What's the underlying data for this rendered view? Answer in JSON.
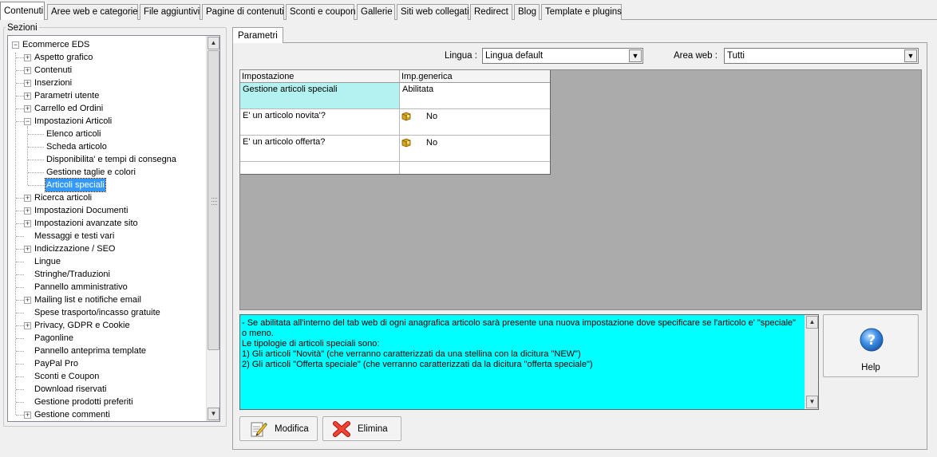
{
  "top_tabs": [
    "Contenuti",
    "Aree web e categorie",
    "File aggiuntivi",
    "Pagine di contenuti",
    "Sconti e coupon",
    "Gallerie",
    "Siti web collegati",
    "Redirect",
    "Blog",
    "Template e plugins"
  ],
  "sections": {
    "legend": "Sezioni",
    "tree": {
      "root": "Ecommerce EDS",
      "items": [
        {
          "label": "Aspetto grafico",
          "expandable": true
        },
        {
          "label": "Contenuti",
          "expandable": true
        },
        {
          "label": "Inserzioni",
          "expandable": true
        },
        {
          "label": "Parametri utente",
          "expandable": true
        },
        {
          "label": "Carrello ed Ordini",
          "expandable": true
        },
        {
          "label": "Impostazioni Articoli",
          "expandable": true,
          "expanded": true,
          "children": [
            "Elenco articoli",
            "Scheda articolo",
            "Disponibilita' e tempi di consegna",
            "Gestione taglie e colori",
            "Articoli speciali"
          ],
          "selected_child": "Articoli speciali"
        },
        {
          "label": "Ricerca articoli",
          "expandable": true
        },
        {
          "label": "Impostazioni Documenti",
          "expandable": true
        },
        {
          "label": "Impostazioni avanzate sito",
          "expandable": true
        },
        {
          "label": "Messaggi e testi vari",
          "expandable": false
        },
        {
          "label": "Indicizzazione / SEO",
          "expandable": true
        },
        {
          "label": "Lingue",
          "expandable": false
        },
        {
          "label": "Stringhe/Traduzioni",
          "expandable": false
        },
        {
          "label": "Pannello amministrativo",
          "expandable": false
        },
        {
          "label": "Mailing list e notifiche email",
          "expandable": true
        },
        {
          "label": "Spese trasporto/incasso gratuite",
          "expandable": false
        },
        {
          "label": "Privacy, GDPR e Cookie",
          "expandable": true
        },
        {
          "label": "Pagonline",
          "expandable": false
        },
        {
          "label": "Pannello anteprima template",
          "expandable": false
        },
        {
          "label": "PayPal Pro",
          "expandable": false
        },
        {
          "label": "Sconti e Coupon",
          "expandable": false
        },
        {
          "label": "Download riservati",
          "expandable": false
        },
        {
          "label": "Gestione prodotti preferiti",
          "expandable": false
        },
        {
          "label": "Gestione commenti",
          "expandable": true
        }
      ]
    }
  },
  "right_tab": "Parametri",
  "filters": {
    "lingua_label": "Lingua :",
    "lingua_value": "Lingua default",
    "area_label": "Area web :",
    "area_value": "Tutti"
  },
  "grid": {
    "headers": [
      "Impostazione",
      "Imp.generica"
    ],
    "rows": [
      {
        "setting": "Gestione articoli speciali",
        "value": "Abilitata",
        "highlight": true,
        "icon": false
      },
      {
        "setting": "E' un articolo novita'?",
        "value": "No",
        "highlight": false,
        "icon": true
      },
      {
        "setting": "E' un articolo offerta?",
        "value": "No",
        "highlight": false,
        "icon": true
      },
      {
        "setting": "",
        "value": "",
        "highlight": false,
        "icon": false
      }
    ]
  },
  "description": "- Se abilitata all'interno del tab web di ogni anagrafica articolo sarà presente una nuova impostazione dove specificare se l'articolo e' \"speciale\" o meno.\nLe tipologie di articoli speciali sono:\n1) Gli articoli \"Novità\" (che verranno caratterizzati da una stellina con la dicitura \"NEW\")\n2) Gli articoli \"Offerta speciale\" (che verranno caratterizzati da la dicitura \"offerta speciale\")",
  "buttons": {
    "modifica": "Modifica",
    "elimina": "Elimina",
    "help": "Help"
  },
  "icons": {
    "modifica": "edit-note-icon",
    "elimina": "red-x-icon",
    "help": "help-question-icon",
    "yesno": "gold-box-icon"
  },
  "colors": {
    "selected": "#3399ff",
    "highlight_cell": "#b4f1f1",
    "description_bg": "#00ffff",
    "grid_bg": "#ababab"
  }
}
